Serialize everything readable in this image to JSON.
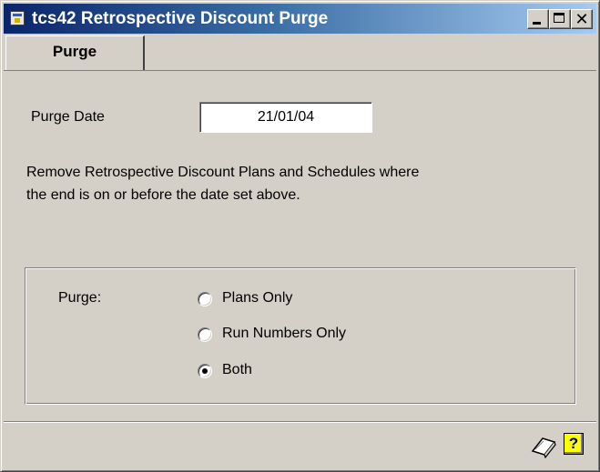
{
  "window": {
    "title": "tcs42 Retrospective Discount Purge",
    "controls": {
      "close_glyph": "✕"
    }
  },
  "tabs": [
    {
      "label": "Purge",
      "active": true
    }
  ],
  "form": {
    "purge_date_label": "Purge Date",
    "purge_date_value": "21/01/04",
    "description_line1": "Remove Retrospective Discount Plans and Schedules where",
    "description_line2": "the end is on or before the date set above.",
    "purge_group": {
      "label": "Purge:",
      "options": [
        {
          "label": "Plans Only",
          "checked": false
        },
        {
          "label": "Run Numbers Only",
          "checked": false
        },
        {
          "label": "Both",
          "checked": true
        }
      ]
    }
  },
  "statusbar": {
    "notes_icon": "note-pad-icon",
    "help_icon": "help-icon",
    "help_glyph": "?"
  }
}
